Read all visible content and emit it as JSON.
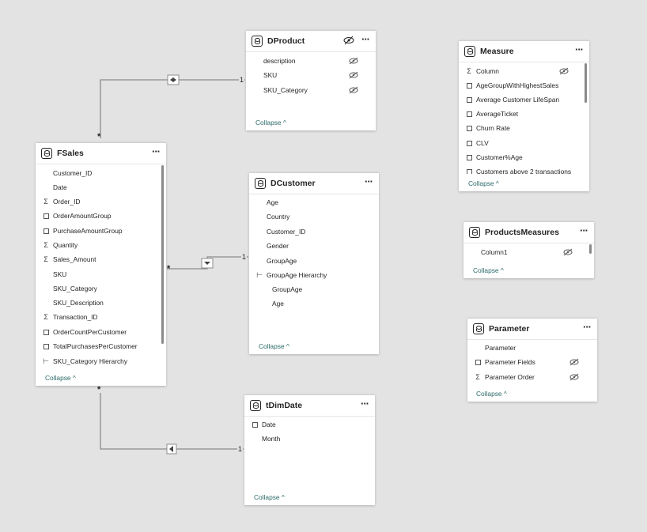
{
  "tables": {
    "dproduct": {
      "title": "DProduct",
      "rows": [
        "description",
        "SKU",
        "SKU_Category"
      ],
      "collapse": "Collapse"
    },
    "measure": {
      "title": "Measure",
      "rows": [
        "Column",
        "AgeGroupWithHighestSales",
        "Average Customer LifeSpan",
        "AverageTicket",
        "Churn Rate",
        "CLV",
        "Customer%Age",
        "Customers above 2 transactions"
      ],
      "collapse": "Collapse"
    },
    "fsales": {
      "title": "FSales",
      "rows": [
        "Customer_ID",
        "Date",
        "Order_ID",
        "OrderAmountGroup",
        "PurchaseAmountGroup",
        "Quantity",
        "Sales_Amount",
        "SKU",
        "SKU_Category",
        "SKU_Description",
        "Transaction_ID",
        "OrderCountPerCustomer",
        "TotalPurchasesPerCustomer",
        "SKU_Category Hierarchy"
      ],
      "collapse": "Collapse"
    },
    "dcustomer": {
      "title": "DCustomer",
      "rows": [
        "Age",
        "Country",
        "Customer_ID",
        "Gender",
        "GroupAge",
        "GroupAge Hierarchy",
        "GroupAge",
        "Age"
      ],
      "collapse": "Collapse"
    },
    "productsmeasures": {
      "title": "ProductsMeasures",
      "rows": [
        "Column1"
      ],
      "collapse": "Collapse"
    },
    "parameter": {
      "title": "Parameter",
      "rows": [
        "Parameter",
        "Parameter Fields",
        "Parameter Order"
      ],
      "collapse": "Collapse"
    },
    "tdimdate": {
      "title": "tDimDate",
      "rows": [
        "Date",
        "Month"
      ],
      "collapse": "Collapse"
    }
  },
  "relationships": {
    "many": "*",
    "one": "1"
  },
  "icons": {
    "more": "more-options-icon",
    "hidden": "eye-hidden-icon",
    "sigma": "sigma-icon",
    "calc": "calculator-icon",
    "hierarchy": "hierarchy-icon",
    "calendar": "calendar-icon"
  },
  "colors": {
    "canvas": "#e4e3e3",
    "card": "#ffffff",
    "collapse": "#2d6a6a",
    "line": "#8c8c8c"
  }
}
